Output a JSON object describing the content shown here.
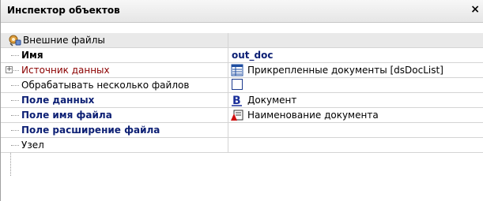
{
  "window": {
    "title": "Инспектор объектов",
    "close_glyph": "×"
  },
  "category": {
    "label": "Внешние файлы",
    "icon": "settings-tools-icon"
  },
  "rows": [
    {
      "label": "Имя",
      "value": "out_doc"
    },
    {
      "label": "Источник данных",
      "value": "Прикрепленные документы [dsDocList]",
      "icon": "table-icon"
    },
    {
      "label": "Обрабатывать несколько файлов",
      "checked": false
    },
    {
      "label": "Поле данных",
      "value": "Документ",
      "icon": "bold-b-icon"
    },
    {
      "label": "Поле имя файла",
      "value": "Наименование документа",
      "icon": "text-field-icon"
    },
    {
      "label": "Поле расширение файла",
      "value": ""
    },
    {
      "label": "Узел",
      "value": ""
    }
  ],
  "colors": {
    "accent": "#0c1f74",
    "required": "#8b0000",
    "category_bg": "#e9e9e9",
    "gridline": "#d4d4d4"
  }
}
